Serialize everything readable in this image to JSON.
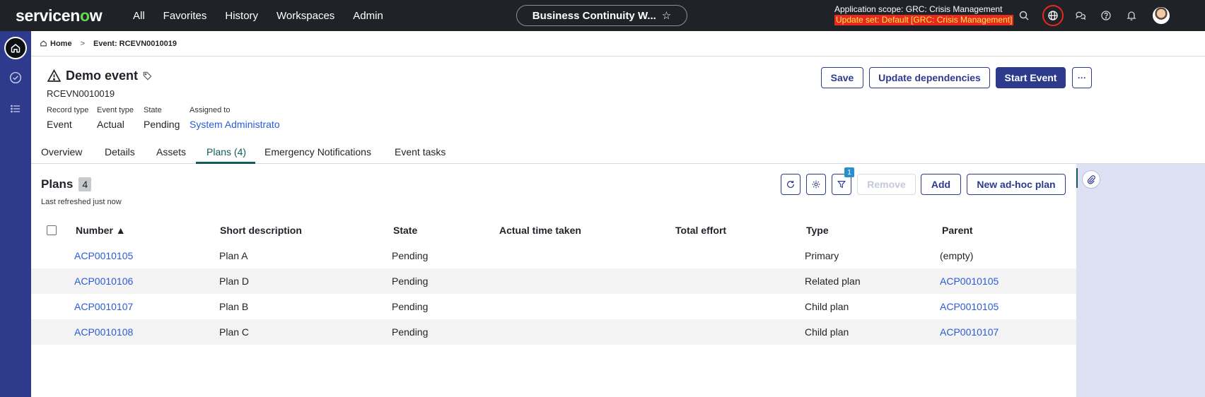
{
  "topbar": {
    "logo_prefix": "servicen",
    "logo_o": "o",
    "logo_suffix": "w",
    "nav": [
      "All",
      "Favorites",
      "History",
      "Workspaces",
      "Admin"
    ],
    "workspace": "Business Continuity W...",
    "scope_line1": "Application scope: GRC: Crisis Management",
    "scope_line2": "Update set: Default [GRC: Crisis Management]",
    "icons": [
      "search-icon",
      "globe-icon",
      "chat-icon",
      "help-icon",
      "bell-icon",
      "avatar"
    ]
  },
  "breadcrumb": {
    "home": "Home",
    "separator": ">",
    "current": "Event: RCEVN0010019"
  },
  "record": {
    "title": "Demo event",
    "number": "RCEVN0010019",
    "fields": [
      {
        "label": "Record type",
        "value": "Event"
      },
      {
        "label": "Event type",
        "value": "Actual"
      },
      {
        "label": "State",
        "value": "Pending"
      },
      {
        "label": "Assigned to",
        "value": "System Administrato"
      }
    ]
  },
  "actions": {
    "save": "Save",
    "update_dependencies": "Update dependencies",
    "start_event": "Start Event",
    "more": "···"
  },
  "tabs": [
    "Overview",
    "Details",
    "Assets",
    "Plans (4)",
    "Emergency Notifications",
    "Event tasks"
  ],
  "active_tab": "Plans (4)",
  "plans": {
    "title": "Plans",
    "count": "4",
    "refreshed": "Last refreshed just now",
    "filter_badge": "1",
    "remove": "Remove",
    "add": "Add",
    "new_adhoc": "New ad-hoc plan",
    "columns": [
      "Number ▲",
      "Short description",
      "State",
      "Actual time taken",
      "Total effort",
      "Type",
      "Parent"
    ],
    "rows": [
      {
        "number": "ACP0010105",
        "short_description": "Plan A",
        "state": "Pending",
        "actual_time": "",
        "total_effort": "",
        "type": "Primary",
        "parent": "(empty)"
      },
      {
        "number": "ACP0010106",
        "short_description": "Plan D",
        "state": "Pending",
        "actual_time": "",
        "total_effort": "",
        "type": "Related plan",
        "parent": "ACP0010105"
      },
      {
        "number": "ACP0010107",
        "short_description": "Plan B",
        "state": "Pending",
        "actual_time": "",
        "total_effort": "",
        "type": "Child plan",
        "parent": "ACP0010105"
      },
      {
        "number": "ACP0010108",
        "short_description": "Plan C",
        "state": "Pending",
        "actual_time": "",
        "total_effort": "",
        "type": "Child plan",
        "parent": "ACP0010107"
      }
    ]
  },
  "colors": {
    "topbar": "#1f2226",
    "rail": "#2e3b8c",
    "primary": "#2e3b8c",
    "link": "#2a5bd7",
    "active_tab": "#0f5c5b",
    "update_set_bg": "#e8291f"
  }
}
